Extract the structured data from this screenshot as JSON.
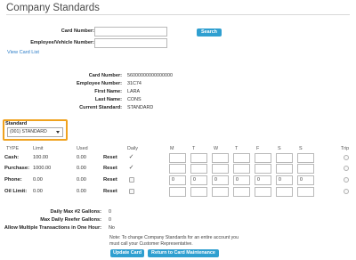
{
  "page": {
    "title": "Company Standards"
  },
  "search": {
    "card_number_label": "Card Number:",
    "card_number_value": "",
    "employee_vehicle_label": "Employee/Vehicle Number:",
    "employee_vehicle_value": "",
    "search_button": "Search",
    "view_card_list_link": "View Card List"
  },
  "card_info": {
    "card_number_label": "Card Number:",
    "card_number": "56000000000000000",
    "employee_number_label": "Employee Number:",
    "employee_number": "31C74",
    "first_name_label": "First Name:",
    "first_name": "LARA",
    "last_name_label": "Last Name:",
    "last_name": "CONS",
    "current_standard_label": "Current Standard:",
    "current_standard": "STANDARD"
  },
  "standard": {
    "label": "Standard",
    "selected": "(001) STANDARD"
  },
  "limits_table": {
    "headers": {
      "type": "TYPE",
      "limit": "Limit",
      "used": "Used",
      "daily": "Daily",
      "days": [
        "M",
        "T",
        "W",
        "T",
        "F",
        "S",
        "S"
      ],
      "trip": "Trip"
    },
    "reset_label": "Reset",
    "rows": [
      {
        "type": "Cash:",
        "limit": "100.00",
        "used": "0.00",
        "daily_checked": true,
        "days": [
          "",
          "",
          "",
          "",
          "",
          "",
          ""
        ],
        "trip_checked": false
      },
      {
        "type": "Purchase:",
        "limit": "1000.00",
        "used": "0.00",
        "daily_checked": true,
        "days": [
          "",
          "",
          "",
          "",
          "",
          "",
          ""
        ],
        "trip_checked": false
      },
      {
        "type": "Phone:",
        "limit": "0.00",
        "used": "0.00",
        "daily_checked": false,
        "days": [
          "0",
          "0",
          "0",
          "0",
          "0",
          "0",
          "0"
        ],
        "trip_checked": false
      },
      {
        "type": "Oil Limit:",
        "limit": "0.00",
        "used": "0.00",
        "daily_checked": false,
        "days": [
          "",
          "",
          "",
          "",
          "",
          "",
          ""
        ],
        "trip_checked": false
      }
    ]
  },
  "extras": {
    "daily_max_label": "Daily Max #2 Gallons:",
    "daily_max_value": "0",
    "reefer_label": "Max Daily Reefer Gallons:",
    "reefer_value": "0",
    "multiple_label": "Allow Multiple Transactions in One Hour:",
    "multiple_value": "No"
  },
  "note": "Note: To change Company Standards for an entire account you must call your Customer Representative.",
  "actions": {
    "update_card": "Update Card",
    "return_button": "Return to Card Maintenance"
  },
  "colors": {
    "accent": "#2f9fd0",
    "highlight": "#f0a21e",
    "link": "#2a7cc7"
  }
}
